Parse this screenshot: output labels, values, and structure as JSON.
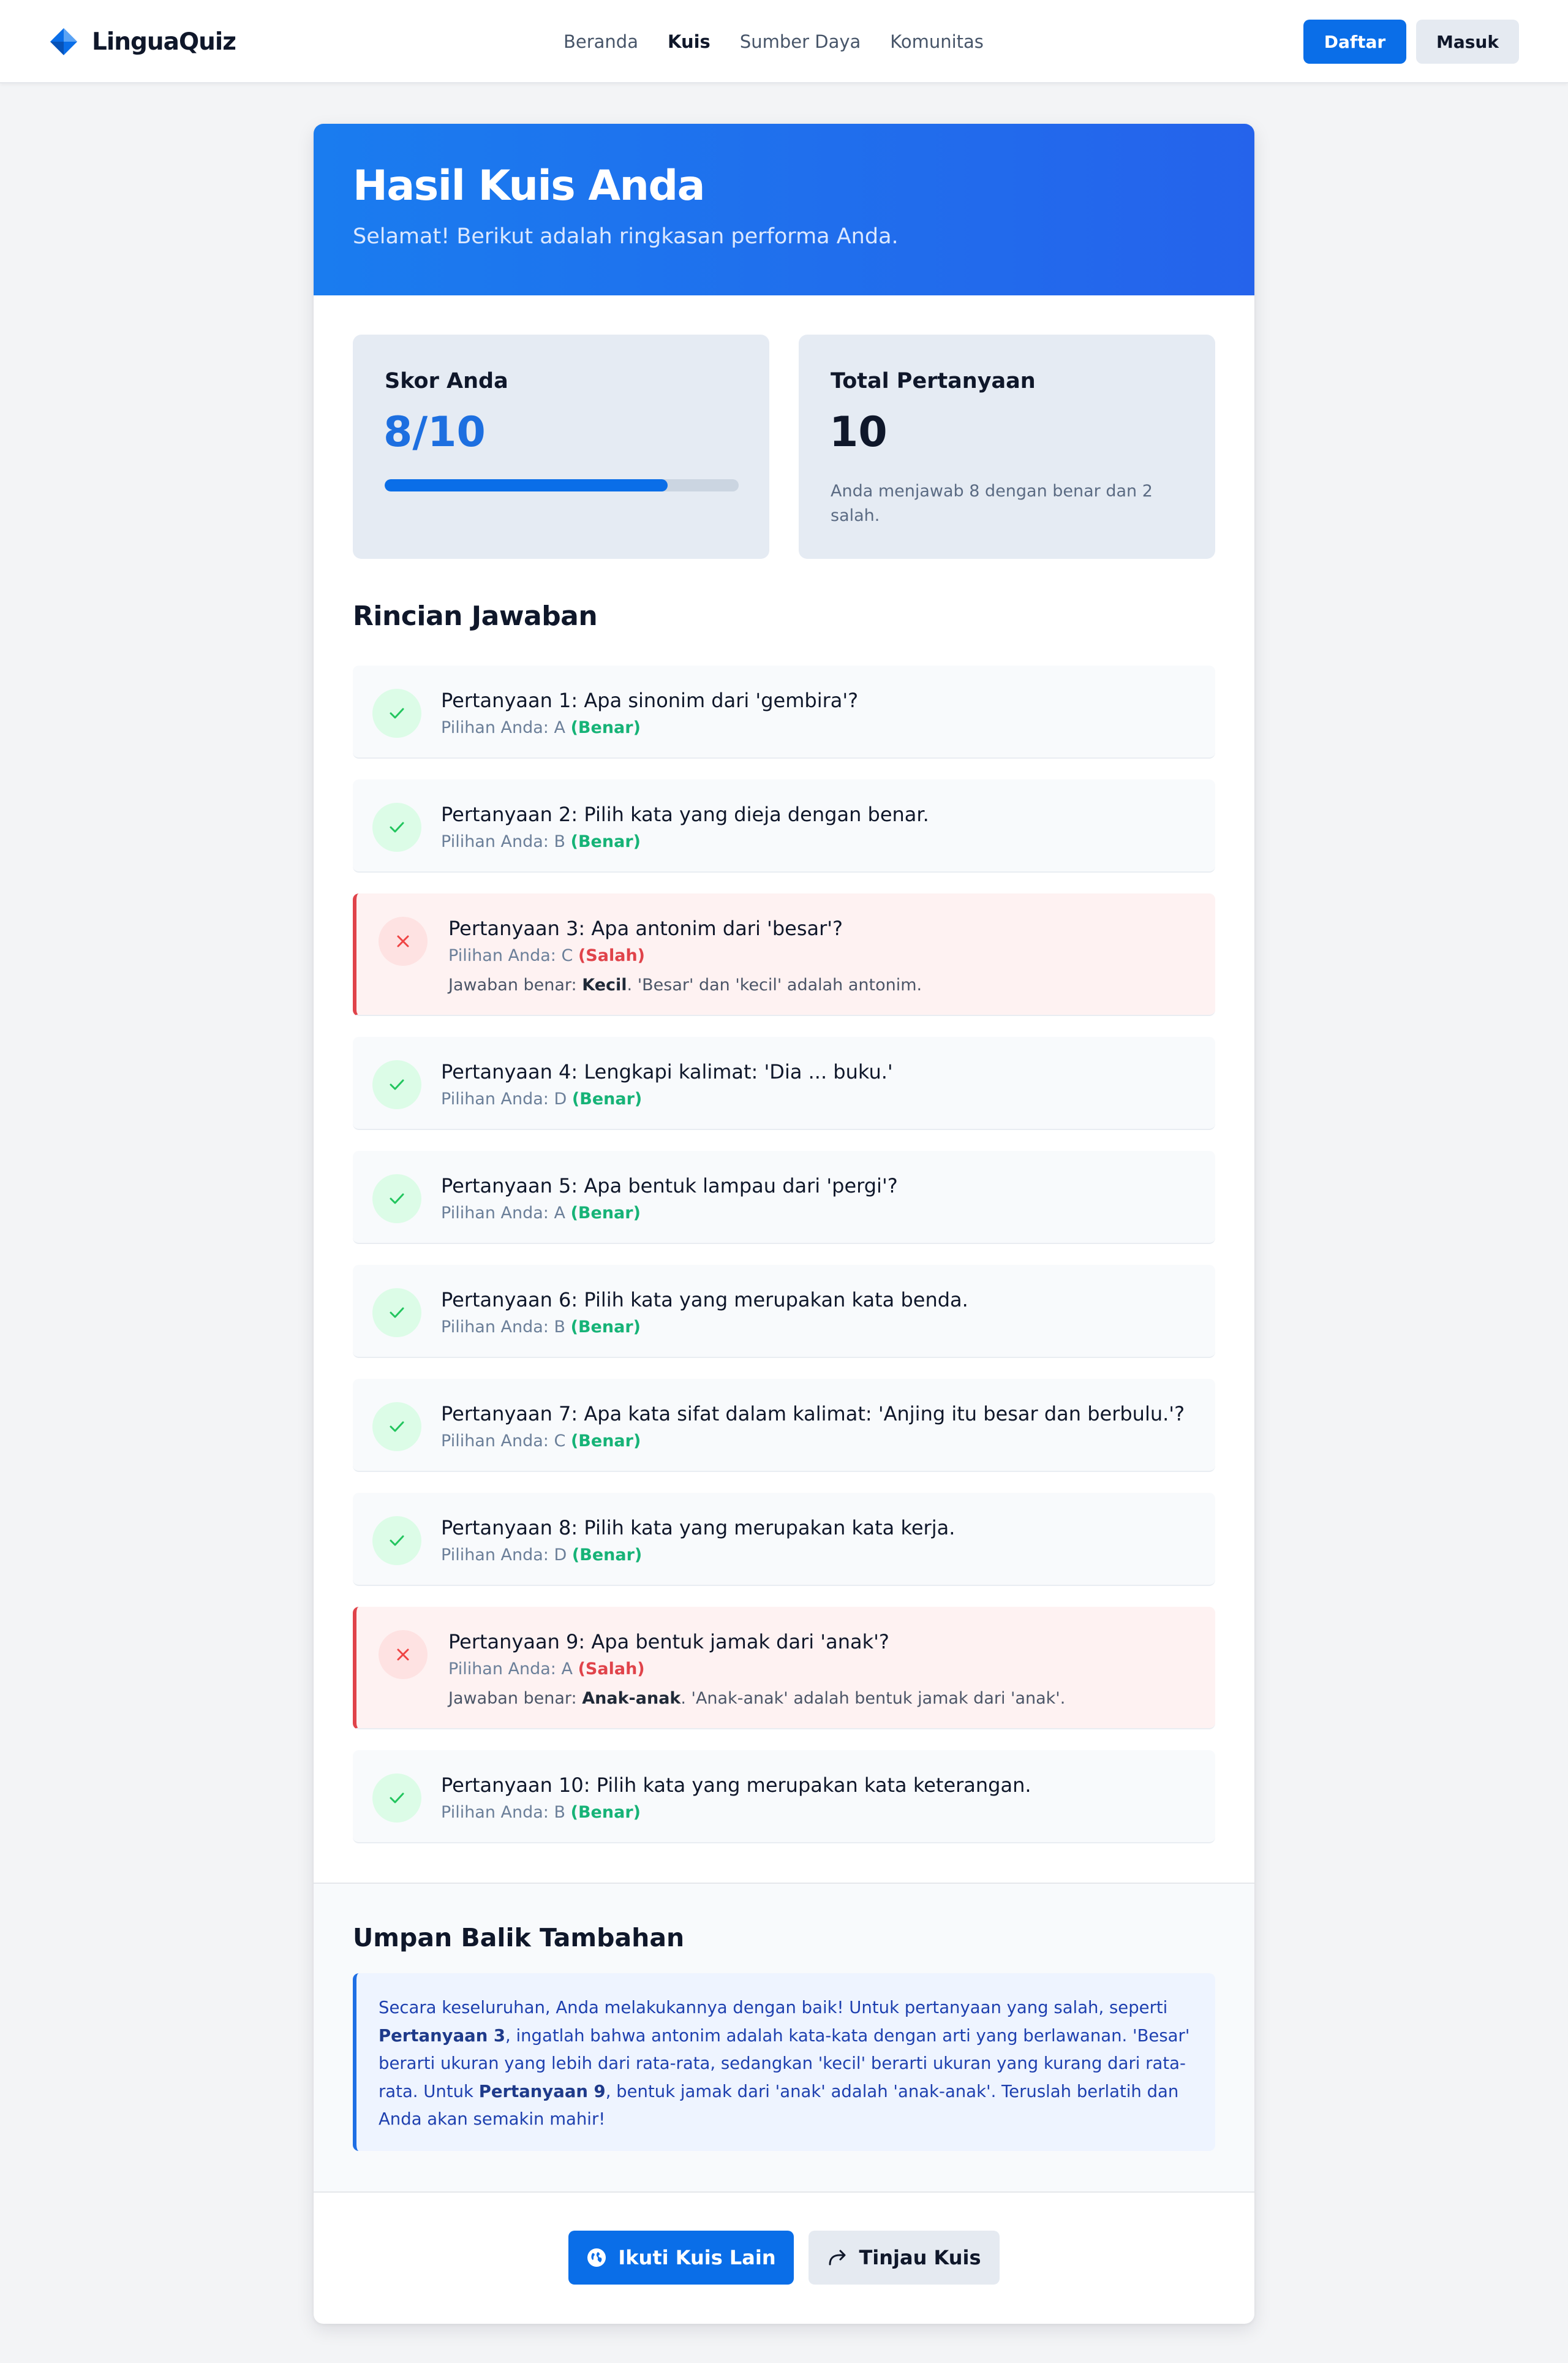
{
  "app": {
    "name": "LinguaQuiz"
  },
  "nav": {
    "links": [
      {
        "label": "Beranda",
        "active": false
      },
      {
        "label": "Kuis",
        "active": true
      },
      {
        "label": "Sumber Daya",
        "active": false
      },
      {
        "label": "Komunitas",
        "active": false
      }
    ],
    "register_label": "Daftar",
    "login_label": "Masuk"
  },
  "hero": {
    "title": "Hasil Kuis Anda",
    "subtitle": "Selamat! Berikut adalah ringkasan performa Anda."
  },
  "stats": {
    "score": {
      "label": "Skor Anda",
      "value": "8/10",
      "progress_fraction": 0.8
    },
    "total": {
      "label": "Total Pertanyaan",
      "value": "10",
      "note": "Anda menjawab 8 dengan benar dan 2 salah."
    }
  },
  "details": {
    "title": "Rincian Jawaban",
    "choice_prefix": "Pilihan Anda:",
    "correct_answer_prefix": "Jawaban benar:",
    "items": [
      {
        "status": "correct",
        "question": "Pertanyaan 1: Apa sinonim dari 'gembira'?",
        "choice": "A",
        "result": "(Benar)"
      },
      {
        "status": "correct",
        "question": "Pertanyaan 2: Pilih kata yang dieja dengan benar.",
        "choice": "B",
        "result": "(Benar)"
      },
      {
        "status": "wrong",
        "question": "Pertanyaan 3: Apa antonim dari 'besar'?",
        "choice": "C",
        "result": "(Salah)",
        "correct_answer": "Kecil",
        "explanation": ". 'Besar' dan 'kecil' adalah antonim."
      },
      {
        "status": "correct",
        "question": "Pertanyaan 4: Lengkapi kalimat: 'Dia ... buku.'",
        "choice": "D",
        "result": "(Benar)"
      },
      {
        "status": "correct",
        "question": "Pertanyaan 5: Apa bentuk lampau dari 'pergi'?",
        "choice": "A",
        "result": "(Benar)"
      },
      {
        "status": "correct",
        "question": "Pertanyaan 6: Pilih kata yang merupakan kata benda.",
        "choice": "B",
        "result": "(Benar)"
      },
      {
        "status": "correct",
        "question": "Pertanyaan 7: Apa kata sifat dalam kalimat: 'Anjing itu besar dan berbulu.'?",
        "choice": "C",
        "result": "(Benar)"
      },
      {
        "status": "correct",
        "question": "Pertanyaan 8: Pilih kata yang merupakan kata kerja.",
        "choice": "D",
        "result": "(Benar)"
      },
      {
        "status": "wrong",
        "question": "Pertanyaan 9: Apa bentuk jamak dari 'anak'?",
        "choice": "A",
        "result": "(Salah)",
        "correct_answer": "Anak-anak",
        "explanation": ". 'Anak-anak' adalah bentuk jamak dari 'anak'."
      },
      {
        "status": "correct",
        "question": "Pertanyaan 10: Pilih kata yang merupakan kata keterangan.",
        "choice": "B",
        "result": "(Benar)"
      }
    ]
  },
  "feedback": {
    "title": "Umpan Balik Tambahan",
    "text_1": "Secara keseluruhan, Anda melakukannya dengan baik! Untuk pertanyaan yang salah, seperti ",
    "ref_1": "Pertanyaan 3",
    "text_2": ", ingatlah bahwa antonim adalah kata-kata dengan arti yang berlawanan. 'Besar' berarti ukuran yang lebih dari rata-rata, sedangkan 'kecil' berarti ukuran yang kurang dari rata-rata. Untuk ",
    "ref_2": "Pertanyaan 9",
    "text_3": ", bentuk jamak dari 'anak' adalah 'anak-anak'. Teruslah berlatih dan Anda akan semakin mahir!"
  },
  "actions": {
    "new_quiz_label": "Ikuti Kuis Lain",
    "new_quiz_icon": "globe-icon",
    "review_label": "Tinjau Kuis",
    "review_icon": "share-arrow-icon"
  },
  "colors": {
    "accent": "#0a6ee8",
    "correct": "#16b377",
    "wrong": "#e0434a",
    "hero_gradient_start": "#1a7cef",
    "hero_gradient_end": "#2563eb"
  }
}
